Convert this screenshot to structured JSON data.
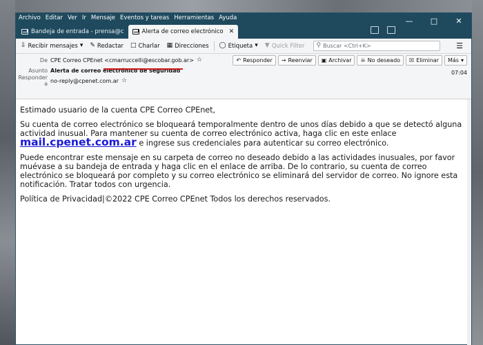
{
  "menu": [
    "Archivo",
    "Editar",
    "Ver",
    "Ir",
    "Mensaje",
    "Eventos y tareas",
    "Herramientas",
    "Ayuda"
  ],
  "tabs": [
    {
      "label": "Bandeja de entrada - prensa@c",
      "active": false
    },
    {
      "label": "Alerta de correo electrónico",
      "active": true
    }
  ],
  "toolbar": {
    "get_mail": "Recibir mensajes",
    "compose": "Redactar",
    "chat": "Charlar",
    "address_book": "Direcciones",
    "tag": "Etiqueta",
    "quick_filter": "Quick Filter",
    "search_placeholder": "Buscar <Ctrl+K>"
  },
  "header": {
    "from_label": "De",
    "from_name": "CPE Correo CPEnet",
    "from_email": "<cmarruccelli@escobar.gob.ar>",
    "subject_label": "Asunto",
    "subject": "Alerta de correo electrónico de seguridad",
    "reply_to_label": "Responder a",
    "reply_to": "no-reply@cpenet.com.ar",
    "time": "07:04",
    "actions": {
      "reply": "Responder",
      "forward": "Reenviar",
      "archive": "Archivar",
      "junk": "No deseado",
      "delete": "Eliminar",
      "more": "Más"
    }
  },
  "message": {
    "greeting": "Estimado usuario de la cuenta CPE Correo CPEnet,",
    "p1_a": "Su cuenta de correo electrónico se bloqueará temporalmente dentro de unos días debido a que se detectó alguna actividad inusual. Para mantener su cuenta de correo electrónico activa, haga clic en este enlace",
    "link": "mail.cpenet.com.ar",
    "p1_b": "e ingrese sus credenciales para autenticar su correo electrónico.",
    "p2": "Puede encontrar este mensaje en su carpeta de correo no deseado debido a las actividades inusuales, por favor muévase a su bandeja de entrada y haga clic en el enlace de arriba. De lo contrario, su cuenta de correo electrónico se bloqueará por completo y su correo electrónico se eliminará del servidor de correo. No ignore esta notificación. Tratar todos con urgencia.",
    "footer": "Política de Privacidad|©2022 CPE Correo CPEnet Todos los derechos reservados."
  },
  "colors": {
    "titlebar": "#1f4a5e",
    "link": "#1a1ad6",
    "highlight": "#d11a1a"
  }
}
